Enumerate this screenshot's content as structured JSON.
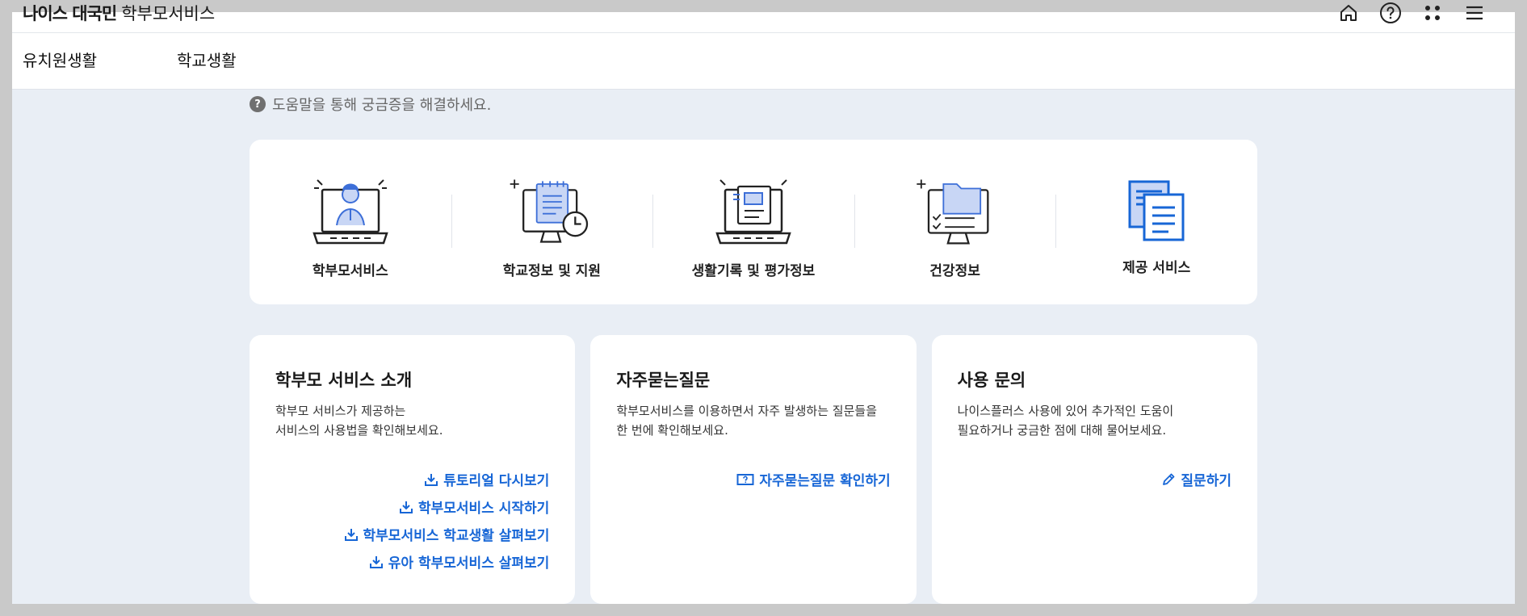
{
  "header": {
    "brand_bold": "나이스 대국민",
    "brand_rest": "학부모서비스",
    "icons": [
      "home-icon",
      "help-icon",
      "apps-icon",
      "menu-icon"
    ]
  },
  "nav": {
    "items": [
      {
        "label": "유치원생활"
      },
      {
        "label": "학교생활"
      }
    ]
  },
  "help": {
    "badge": "?",
    "text": "도움말을 통해 궁금증을 해결하세요."
  },
  "services": [
    {
      "label": "학부모서비스",
      "icon": "parent-laptop-icon"
    },
    {
      "label": "학교정보 및 지원",
      "icon": "school-info-monitor-icon"
    },
    {
      "label": "생활기록 및 평가정보",
      "icon": "record-laptop-icon"
    },
    {
      "label": "건강정보",
      "icon": "health-folder-monitor-icon"
    },
    {
      "label": "제공 서비스",
      "icon": "documents-icon"
    }
  ],
  "cards": [
    {
      "title": "학부모 서비스 소개",
      "desc": "학부모 서비스가 제공하는\n서비스의 사용법을 확인해보세요.",
      "links": [
        {
          "label": "튜토리얼 다시보기",
          "icon": "download-icon"
        },
        {
          "label": "학부모서비스 시작하기",
          "icon": "download-icon"
        },
        {
          "label": "학부모서비스 학교생활 살펴보기",
          "icon": "download-icon"
        },
        {
          "label": "유아 학부모서비스 살펴보기",
          "icon": "download-icon"
        }
      ]
    },
    {
      "title": "자주묻는질문",
      "desc": "학부모서비스를 이용하면서 자주 발생하는 질문들을\n한 번에 확인해보세요.",
      "links": [
        {
          "label": "자주묻는질문 확인하기",
          "icon": "faq-icon"
        }
      ]
    },
    {
      "title": "사용 문의",
      "desc": "나이스플러스 사용에 있어 추가적인 도움이\n필요하거나 궁금한 점에 대해 물어보세요.",
      "links": [
        {
          "label": "질문하기",
          "icon": "pencil-icon"
        }
      ]
    }
  ],
  "colors": {
    "accent": "#1766d6",
    "icon_blue": "#3d6fd8",
    "icon_light": "#c8d6f5",
    "background": "#e9eef5"
  }
}
